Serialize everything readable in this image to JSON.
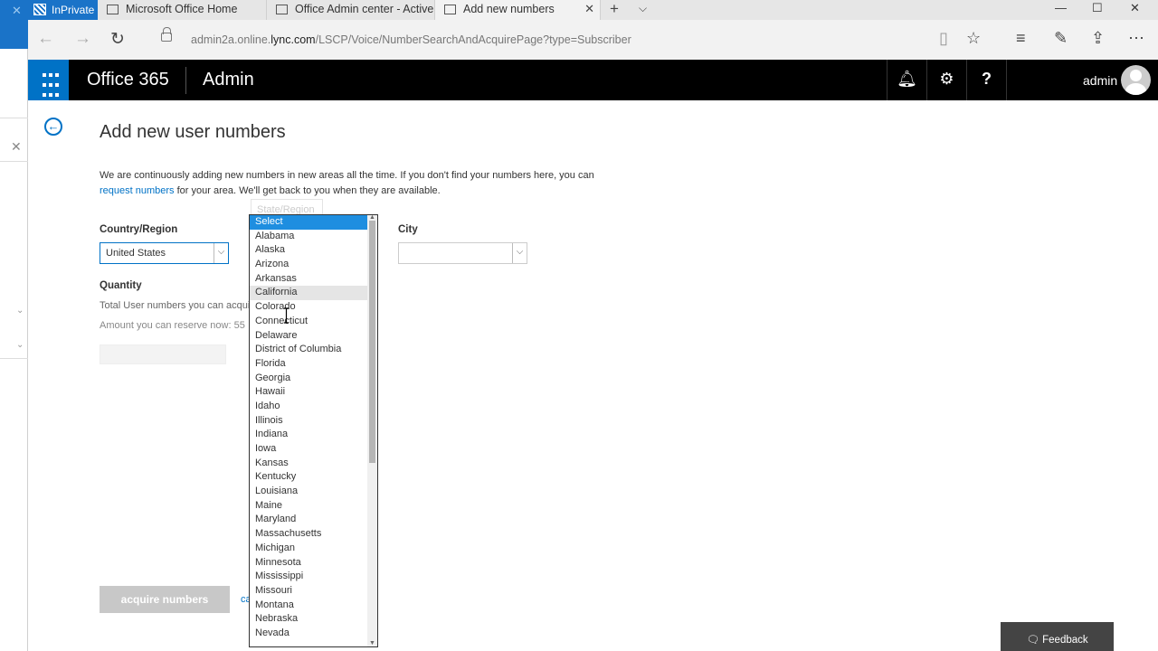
{
  "browser": {
    "inprivate_label": "InPrivate",
    "tabs": [
      {
        "label": "Microsoft Office Home",
        "active": false
      },
      {
        "label": "Office Admin center - Active",
        "active": false
      },
      {
        "label": "Add new numbers",
        "active": true
      }
    ],
    "url_domain_pre": "admin2a.online.",
    "url_domain_main": "lync.com",
    "url_path": "/LSCP/Voice/NumberSearchAndAcquirePage?type=Subscriber"
  },
  "header": {
    "brand": "Office 365",
    "section": "Admin",
    "user": "admin"
  },
  "page": {
    "title": "Add new user numbers",
    "intro_text_1": "We are continuously adding new numbers in new areas all the time. If you don't find your numbers here, you can",
    "intro_link": "request numbers",
    "intro_text_2": " for your area. We'll get back to you when they are available.",
    "country_label": "Country/Region",
    "country_value": "United States",
    "state_ghost": "State/Region",
    "city_label": "City",
    "quantity_label": "Quantity",
    "total_text": "Total User numbers you can acqui",
    "reserve_text": "Amount you can reserve now: 55",
    "acquire_label": "acquire numbers",
    "cancel_label": "ca",
    "feedback_label": "Feedback"
  },
  "dropdown": {
    "options": [
      "Select",
      "Alabama",
      "Alaska",
      "Arizona",
      "Arkansas",
      "California",
      "Colorado",
      "Connecticut",
      "Delaware",
      "District of Columbia",
      "Florida",
      "Georgia",
      "Hawaii",
      "Idaho",
      "Illinois",
      "Indiana",
      "Iowa",
      "Kansas",
      "Kentucky",
      "Louisiana",
      "Maine",
      "Maryland",
      "Massachusetts",
      "Michigan",
      "Minnesota",
      "Mississippi",
      "Missouri",
      "Montana",
      "Nebraska",
      "Nevada"
    ],
    "selected": "Select",
    "hovered": "California"
  },
  "colors": {
    "accent": "#0072c6",
    "selection": "#1e8ee0",
    "header_bg": "#000000"
  }
}
